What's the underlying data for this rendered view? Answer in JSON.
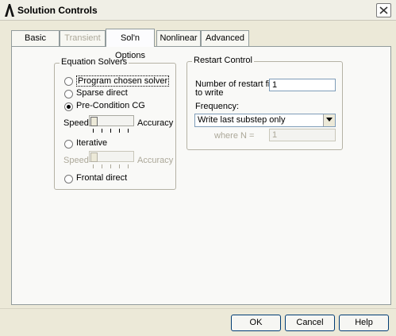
{
  "window": {
    "title": "Solution Controls",
    "app_icon": "ansys-lambda-icon",
    "close_icon": "close-icon"
  },
  "tabs": [
    {
      "label": "Basic",
      "state": "normal"
    },
    {
      "label": "Transient",
      "state": "disabled"
    },
    {
      "label": "Sol'n Options",
      "state": "active"
    },
    {
      "label": "Nonlinear",
      "state": "normal"
    },
    {
      "label": "Advanced NL",
      "state": "normal"
    }
  ],
  "equation_solvers": {
    "title": "Equation Solvers",
    "options": [
      {
        "label": "Program chosen solver",
        "checked": false,
        "enabled": true
      },
      {
        "label": "Sparse direct",
        "checked": false,
        "enabled": true
      },
      {
        "label": "Pre-Condition CG",
        "checked": true,
        "enabled": true
      },
      {
        "label": "Iterative",
        "checked": false,
        "enabled": true
      },
      {
        "label": "Frontal direct",
        "checked": false,
        "enabled": true
      }
    ],
    "slider1": {
      "left_label": "Speed",
      "right_label": "Accuracy",
      "level": 0.0,
      "enabled": true
    },
    "slider2": {
      "left_label": "Speed",
      "right_label": "Accuracy",
      "level": 0.0,
      "enabled": false
    }
  },
  "restart_control": {
    "title": "Restart Control",
    "num_files_label_line1": "Number of restart files",
    "num_files_label_line2": "to write",
    "num_files_value": "1",
    "frequency_label": "Frequency:",
    "frequency_selected": "Write last substep only",
    "where_n_label": "where N =",
    "where_n_value": "1"
  },
  "buttons": {
    "ok": "OK",
    "cancel": "Cancel",
    "help": "Help"
  }
}
